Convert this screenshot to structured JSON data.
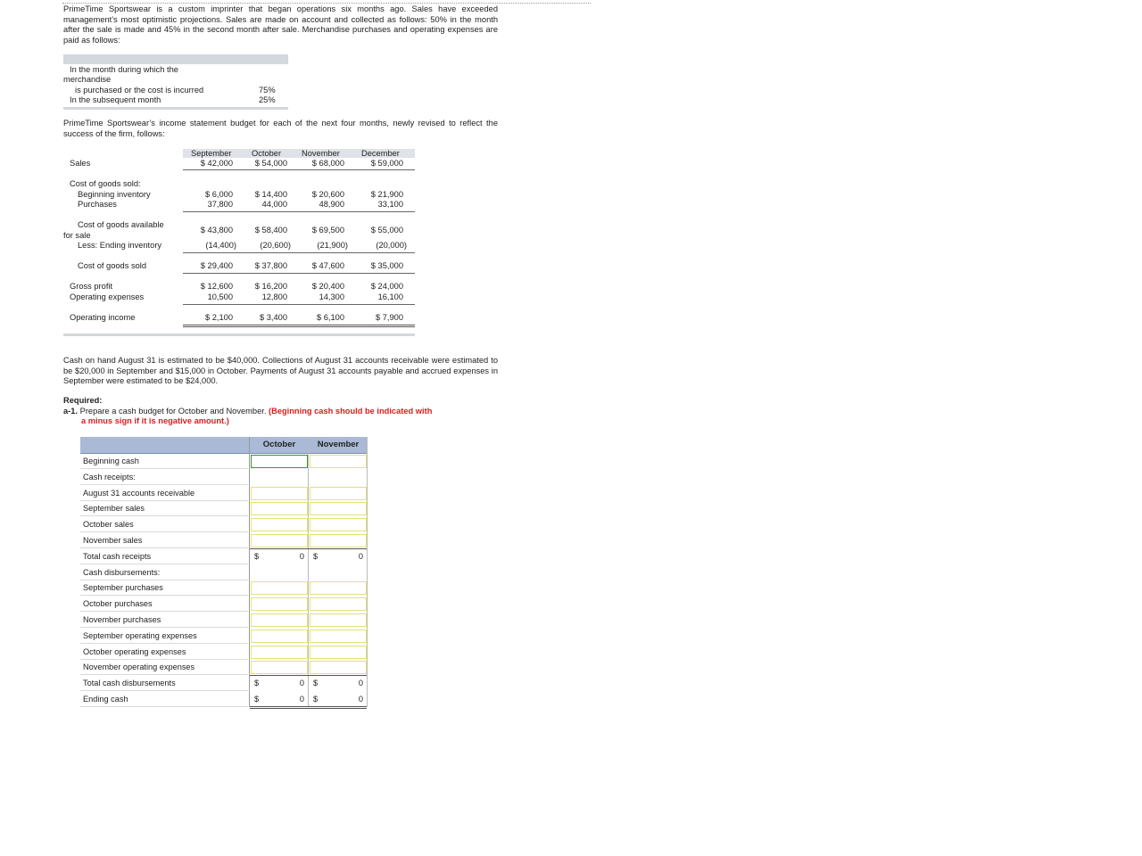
{
  "intro": "PrimeTime Sportswear is a custom imprinter that began operations six months ago. Sales have exceeded management’s most optimistic projections. Sales are made on account and collected as follows: 50% in the month after the sale is made and 45% in the second month after sale. Merchandise purchases and operating expenses are paid as follows:",
  "payment_terms": {
    "row1_line1": "In the month during which the",
    "row1_line2": "merchandise",
    "row1_line3": "is purchased or the cost is incurred",
    "row1_value": "75%",
    "row2_label": "In the subsequent month",
    "row2_value": "25%"
  },
  "budget_intro": "PrimeTime Sportswear’s income statement budget for each of the next four months, newly revised to reflect the success of the firm, follows:",
  "income_statement": {
    "months": [
      "September",
      "October",
      "November",
      "December"
    ],
    "sales_label": "Sales",
    "sales": [
      "$ 42,000",
      "$ 54,000",
      "$ 68,000",
      "$ 59,000"
    ],
    "cogs_label": "Cost of goods sold:",
    "beg_inv_label": "Beginning inventory",
    "beg_inv": [
      "$ 6,000",
      "$ 14,400",
      "$ 20,600",
      "$ 21,900"
    ],
    "purchases_label": "Purchases",
    "purchases": [
      "37,800",
      "44,000",
      "48,900",
      "33,100"
    ],
    "avail_label_1": "Cost of goods available",
    "avail_label_2": "for sale",
    "avail": [
      "$ 43,800",
      "$ 58,400",
      "$ 69,500",
      "$ 55,000"
    ],
    "end_inv_label": "Less: Ending inventory",
    "end_inv": [
      "(14,400)",
      "(20,600)",
      "(21,900)",
      "(20,000)"
    ],
    "cogs_total_label": "Cost of goods sold",
    "cogs": [
      "$ 29,400",
      "$ 37,800",
      "$ 47,600",
      "$ 35,000"
    ],
    "gp_label": "Gross profit",
    "gp": [
      "$ 12,600",
      "$ 16,200",
      "$ 20,400",
      "$ 24,000"
    ],
    "opex_label": "Operating expenses",
    "opex": [
      "10,500",
      "12,800",
      "14,300",
      "16,100"
    ],
    "oi_label": "Operating income",
    "oi": [
      "$ 2,100",
      "$ 3,400",
      "$ 6,100",
      "$ 7,900"
    ]
  },
  "cash_info": "Cash on hand August 31 is estimated to be $40,000. Collections of August 31 accounts receivable were estimated to be $20,000 in September and $15,000 in October. Payments of August 31 accounts payable and accrued expenses in September were estimated to be $24,000.",
  "required": {
    "heading": "Required:",
    "item_num": "a-1.",
    "item_text": "Prepare a cash budget for October and November.",
    "item_note_1": "(Beginning cash should be indicated with",
    "item_note_2": "a minus sign if it is negative amount.)"
  },
  "cash_budget": {
    "col_october": "October",
    "col_november": "November",
    "rows": [
      "Beginning cash",
      "Cash receipts:",
      "August 31 accounts receivable",
      "September sales",
      "October sales",
      "November sales",
      "Total cash receipts",
      "Cash disbursements:",
      "September purchases",
      "October purchases",
      "November purchases",
      "September operating expenses",
      "October operating expenses",
      "November operating expenses",
      "Total cash disbursements",
      "Ending cash"
    ],
    "currency": "$",
    "total_receipts": [
      "0",
      "0"
    ],
    "total_disbursements": [
      "0",
      "0"
    ],
    "ending_cash": [
      "0",
      "0"
    ]
  }
}
